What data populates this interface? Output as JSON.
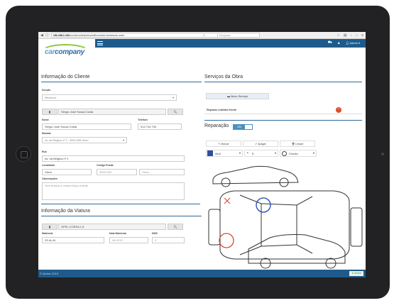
{
  "browser": {
    "url_host": "192.168.1.102",
    "url_path": "/srv/demo/tests/frontoffice/index.html#work-order",
    "reload": "C",
    "search_placeholder": "Pesquisar"
  },
  "app": {
    "logo_part1": "car",
    "logo_part2": "company",
    "user": "Admin"
  },
  "client": {
    "title": "Informação do Cliente",
    "section_label": "Secção",
    "section_value": "Mecânica",
    "search_name": "Sérgio José Sousa Costa",
    "name_label": "Nome",
    "name_value": "Sérgio José Sousa Costa",
    "phone_label": "Telefone",
    "phone_value": "913 744 700",
    "address_label": "Morada",
    "address_value": "Av. da Bélgica nº 2 - 3500-658 Viseu",
    "street_label": "Rua",
    "street_value": "Av. da Bélgica nº 2",
    "city_label": "Localidade",
    "city_value": "Viseu",
    "zip_label": "Código Postal",
    "zip_value": "3500-000",
    "zip_city": "Viseu",
    "notes_label": "Observações",
    "notes_value": "Vem buscar a viatura terça à tarde"
  },
  "vehicle": {
    "title": "Informação da Viatura",
    "model": "OPEL CORSA 1.5",
    "plate_label": "Matrícula",
    "plate_value": "25-IA-44",
    "date_label": "Data Matrícula",
    "date_value": "08-2015",
    "km_label": "KMS",
    "km_value": "0"
  },
  "services": {
    "title": "Serviços da Obra",
    "new_button": "Novo Serviço",
    "item": "Reparar colisão frente"
  },
  "repair": {
    "title": "Reparação",
    "toggle": "ON",
    "mark_btn": "Marcar",
    "erase_btn": "Apagar",
    "clear_btn": "Limpar",
    "color": "Azul",
    "color_hex": "#2d4fa0",
    "size": "5",
    "shape": "Círculo"
  },
  "footer": {
    "copyright": "© Alubex 2015",
    "status": "Online"
  }
}
